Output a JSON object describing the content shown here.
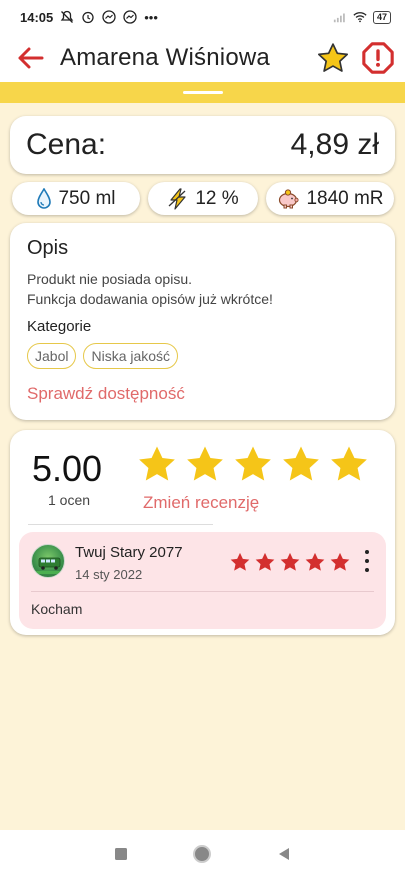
{
  "status_bar": {
    "time": "14:05",
    "dots": "•••",
    "battery": "47"
  },
  "header": {
    "title": "Amarena Wiśniowa"
  },
  "price": {
    "label": "Cena:",
    "value": "4,89 zł"
  },
  "stats": {
    "volume": "750 ml",
    "alcohol": "12 %",
    "mr": "1840 mR"
  },
  "description": {
    "title": "Opis",
    "line1": "Produkt nie posiada opisu.",
    "line2": "Funkcja dodawania opisów już wkrótce!",
    "categories_title": "Kategorie",
    "tags": [
      "Jabol",
      "Niska jakość"
    ],
    "availability_link": "Sprawdź dostępność"
  },
  "rating": {
    "average": "5.00",
    "count": "1 ocen",
    "stars": 5,
    "change_review_label": "Zmień recenzję"
  },
  "reviews": [
    {
      "author": "Twuj Stary 2077",
      "date": "14 sty 2022",
      "stars": 5,
      "text": "Kocham"
    }
  ],
  "colors": {
    "accent_red": "#d32f2f",
    "link_red": "#e06a6a",
    "star_yellow": "#f5c518",
    "strip_yellow": "#f7d64a",
    "background": "#fdf3d8",
    "review_bg": "#fde4e7"
  }
}
